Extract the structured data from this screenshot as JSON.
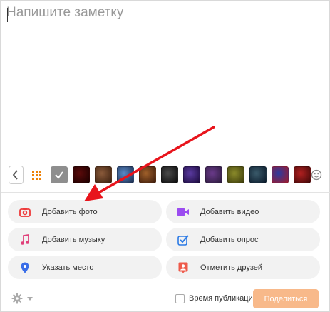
{
  "note": {
    "placeholder": "Напишите заметку"
  },
  "backgrounds": {
    "swatches": [
      {
        "kind": "pattern",
        "icon": "grid-icon"
      },
      {
        "kind": "color",
        "color": "#8e8e8e",
        "icon": "check-icon"
      },
      {
        "kind": "image",
        "c1": "#5a0a0a",
        "c2": "#1a0000"
      },
      {
        "kind": "image",
        "c1": "#8a5a3a",
        "c2": "#3a2010"
      },
      {
        "kind": "image",
        "c1": "#5a8ac8",
        "c2": "#1a2a4a"
      },
      {
        "kind": "image",
        "c1": "#a0602a",
        "c2": "#3a1a0a"
      },
      {
        "kind": "image",
        "c1": "#4a4a4a",
        "c2": "#0a0a0a"
      },
      {
        "kind": "image",
        "c1": "#5a3aa0",
        "c2": "#1a0a3a"
      },
      {
        "kind": "image",
        "c1": "#6a3a8a",
        "c2": "#2a1a3a"
      },
      {
        "kind": "image",
        "c1": "#8a8a2a",
        "c2": "#3a3a0a"
      },
      {
        "kind": "image",
        "c1": "#3a5a6a",
        "c2": "#0a1a2a"
      },
      {
        "kind": "image",
        "c1": "#2a3aa0",
        "c2": "#a01a2a"
      },
      {
        "kind": "image",
        "c1": "#b02020",
        "c2": "#400808"
      }
    ]
  },
  "actions": {
    "add_photo": "Добавить фото",
    "add_video": "Добавить видео",
    "add_music": "Добавить музыку",
    "add_poll": "Добавить опрос",
    "add_place": "Указать место",
    "tag_friends": "Отметить друзей"
  },
  "colors": {
    "photo_icon": "#ee3a3a",
    "video_icon": "#9b4cf0",
    "music_icon": "#e0407a",
    "poll_icon": "#2c7be5",
    "place_icon": "#3a6ee8",
    "friends_icon": "#ee5a4a",
    "share_button": "#f8b98a",
    "annotation_arrow": "#e8141c"
  },
  "footer": {
    "publish_time_label": "Время публикации",
    "share_label": "Поделиться"
  }
}
